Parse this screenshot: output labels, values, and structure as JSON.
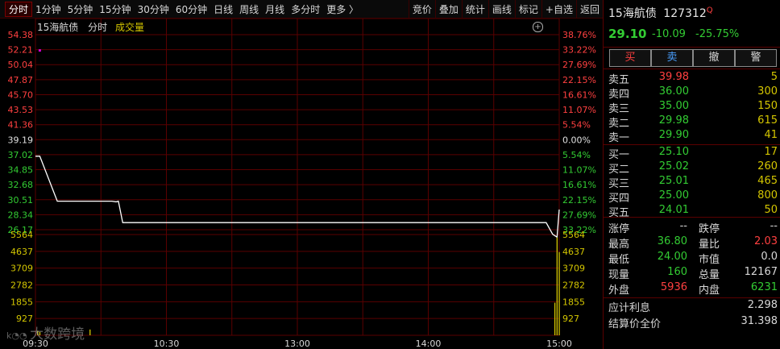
{
  "toolbar": {
    "tabs": [
      "分时",
      "1分钟",
      "5分钟",
      "15分钟",
      "30分钟",
      "60分钟",
      "日线",
      "周线",
      "月线",
      "多分时",
      "更多 〉"
    ],
    "right": [
      "竞价",
      "叠加",
      "统计",
      "画线",
      "标记",
      "+自选",
      "返回"
    ]
  },
  "chart_header": {
    "name": "15海航债",
    "mode": "分时",
    "indicator": "成交量"
  },
  "colors": {
    "up": "#ff4040",
    "down": "#33cc33",
    "flat": "#e0e0e0",
    "volume": "#d4c600",
    "grid": "#5a0000",
    "price_line": "#ffffff",
    "tag": "#d000d0"
  },
  "chart_data": {
    "type": "line",
    "price_ticks_left": [
      "54.38",
      "52.21",
      "50.04",
      "47.87",
      "45.70",
      "43.53",
      "41.36",
      "39.19",
      "37.02",
      "34.85",
      "32.68",
      "30.51",
      "28.34",
      "26.17"
    ],
    "pct_ticks_right": [
      "38.76%",
      "33.22%",
      "27.69%",
      "22.15%",
      "16.61%",
      "11.07%",
      "5.54%",
      "0.00%",
      "5.54%",
      "11.07%",
      "16.61%",
      "22.15%",
      "27.69%",
      "33.22%"
    ],
    "vol_ticks": [
      "5564",
      "4637",
      "3709",
      "2782",
      "1855",
      "927"
    ],
    "x_labels": [
      "09:30",
      "10:30",
      "13:00",
      "14:00",
      "15:00"
    ],
    "ylim": [
      26.17,
      54.38
    ],
    "prev_close": 39.19,
    "series": [
      {
        "x": [
          0,
          2,
          10,
          12,
          35,
          37,
          38,
          40,
          60,
          90,
          120,
          150,
          180,
          210,
          234,
          237,
          239,
          240
        ],
        "values": [
          36.8,
          36.8,
          30.3,
          30.3,
          30.3,
          30.2,
          30.3,
          27.2,
          27.2,
          27.2,
          27.2,
          27.2,
          27.2,
          27.2,
          27.2,
          25.5,
          25.1,
          29.1
        ]
      }
    ],
    "volume": {
      "x": [
        1,
        2,
        25,
        238,
        239,
        240
      ],
      "values": [
        250,
        180,
        320,
        1800,
        5400,
        4600
      ]
    },
    "max_marker": 52.1
  },
  "watermark": "大数跨境",
  "panel": {
    "name": "15海航债",
    "code": "127312",
    "code_mark": "Q",
    "price": "29.10",
    "change": "-10.09",
    "change_pct": "-25.75%",
    "buttons": [
      "买",
      "卖",
      "撤",
      "警"
    ],
    "asks": [
      {
        "label": "卖五",
        "price": "39.98",
        "vol": "5",
        "color": "#ff4040"
      },
      {
        "label": "卖四",
        "price": "36.00",
        "vol": "300",
        "color": "#33cc33"
      },
      {
        "label": "卖三",
        "price": "35.00",
        "vol": "150",
        "color": "#33cc33"
      },
      {
        "label": "卖二",
        "price": "29.98",
        "vol": "615",
        "color": "#33cc33"
      },
      {
        "label": "卖一",
        "price": "29.90",
        "vol": "41",
        "color": "#33cc33"
      }
    ],
    "bids": [
      {
        "label": "买一",
        "price": "25.10",
        "vol": "17"
      },
      {
        "label": "买二",
        "price": "25.02",
        "vol": "260"
      },
      {
        "label": "买三",
        "price": "25.01",
        "vol": "465"
      },
      {
        "label": "买四",
        "price": "25.00",
        "vol": "800"
      },
      {
        "label": "买五",
        "price": "24.01",
        "vol": "50"
      }
    ],
    "stats": [
      {
        "l1": "涨停",
        "v1": "--",
        "c1": "#d8d8d8",
        "l2": "跌停",
        "v2": "--",
        "c2": "#d8d8d8"
      },
      {
        "l1": "最高",
        "v1": "36.80",
        "c1": "#33cc33",
        "l2": "量比",
        "v2": "2.03",
        "c2": "#ff4040"
      },
      {
        "l1": "最低",
        "v1": "24.00",
        "c1": "#33cc33",
        "l2": "市值",
        "v2": "0.0",
        "c2": "#d8d8d8"
      },
      {
        "l1": "现量",
        "v1": "160",
        "c1": "#33cc33",
        "l2": "总量",
        "v2": "12167",
        "c2": "#d8d8d8"
      },
      {
        "l1": "外盘",
        "v1": "5936",
        "c1": "#ff4040",
        "l2": "内盘",
        "v2": "6231",
        "c2": "#33cc33"
      }
    ],
    "interest_label": "应计利息",
    "interest_value": "2.298",
    "settle_label": "结算价全价",
    "settle_value": "31.398"
  }
}
